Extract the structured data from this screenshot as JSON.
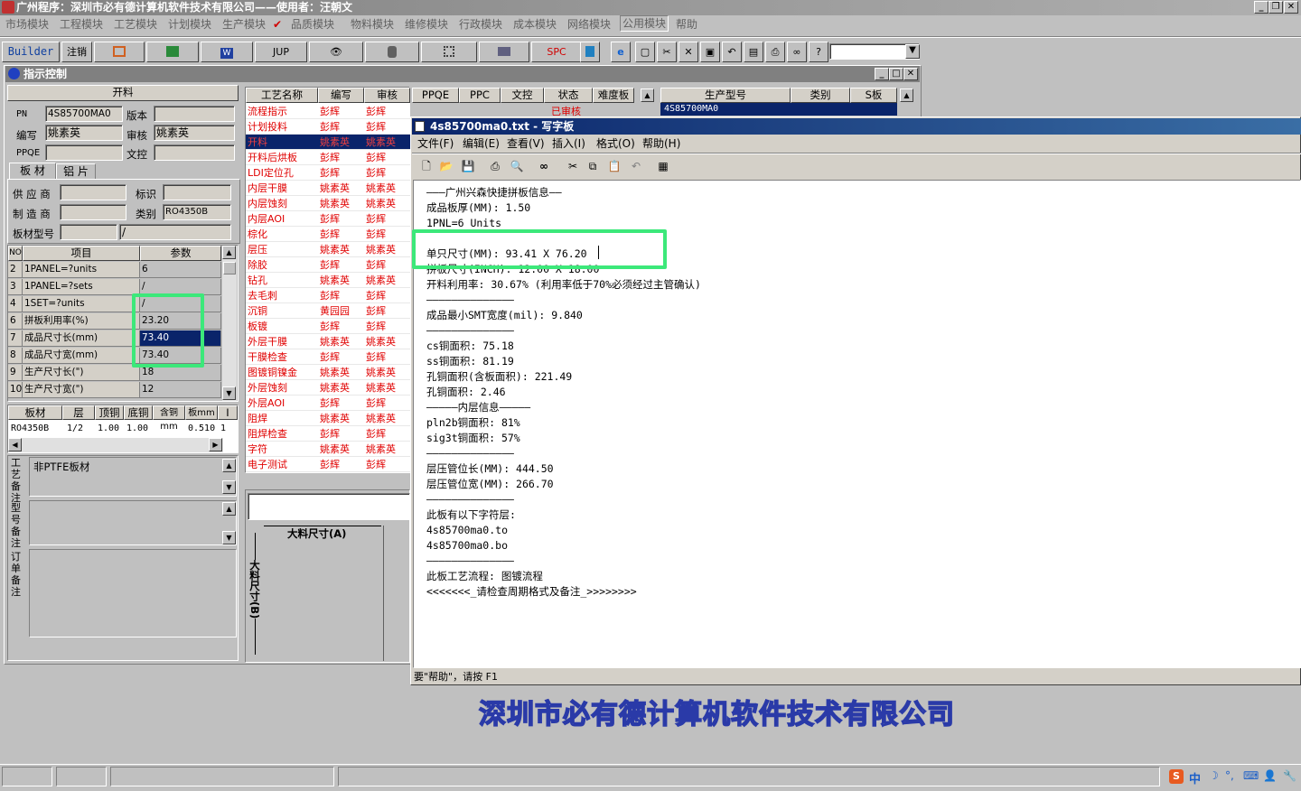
{
  "app": {
    "title": "广州程序：深圳市必有德计算机软件技术有限公司——使用者：汪朝文",
    "menu": [
      "市场模块",
      "工程模块",
      "工艺模块",
      "计划模块",
      "生产模块",
      "品质模块",
      "物料模块",
      "维修模块",
      "行政模块",
      "成本模块",
      "网络模块",
      "公用模块",
      "帮助"
    ],
    "toolbar": {
      "builder": "Builder",
      "logout": "注销",
      "jup": "JUP",
      "spc": "SPC"
    },
    "footer_company": "深圳市必有德计算机软件技术有限公司"
  },
  "panel": {
    "title": "指示控制",
    "section": "开料",
    "pn_label": "PN",
    "pn": "4S85700MA0",
    "version_label": "版本",
    "version": "",
    "author_label": "编写",
    "author": "姚素英",
    "review_label": "审核",
    "reviewer": "姚素英",
    "ppqe_label": "PPQE",
    "ppqe": "",
    "doc_label": "文控",
    "doc": "",
    "tabs": [
      "板 材",
      "铝 片"
    ],
    "supplier_label": "供 应 商",
    "supplier": "",
    "mark_label": "标识",
    "mark": "",
    "maker_label": "制 造 商",
    "maker": "",
    "type_label": "类别",
    "type": "RO4350B",
    "model_label": "板材型号",
    "model": "",
    "model2": "/",
    "param_headers": [
      "NO",
      "项目",
      "参数"
    ],
    "params": [
      {
        "no": "2",
        "item": "1PANEL=?units",
        "val": "6"
      },
      {
        "no": "3",
        "item": "1PANEL=?sets",
        "val": "/"
      },
      {
        "no": "4",
        "item": "1SET=?units",
        "val": "/"
      },
      {
        "no": "6",
        "item": "拼板利用率(%)",
        "val": "23.20"
      },
      {
        "no": "7",
        "item": "成品尺寸长(mm)",
        "val": "73.40"
      },
      {
        "no": "8",
        "item": "成品尺寸宽(mm)",
        "val": "73.40"
      },
      {
        "no": "9",
        "item": "生产尺寸长(\")",
        "val": "18"
      },
      {
        "no": "10",
        "item": "生产尺寸宽(\")",
        "val": "12"
      }
    ],
    "mat_headers": [
      "板材",
      "层",
      "顶铜",
      "底铜",
      "含铜mm",
      "板mm",
      "I"
    ],
    "mat_row": [
      "RO4350B",
      "1/2",
      "1.00",
      "1.00",
      "",
      "0.510",
      "1"
    ],
    "note_labels": [
      "工艺备注",
      "型号备注",
      "订单备注"
    ],
    "note1": "非PTFE板材"
  },
  "process": {
    "headers": [
      "工艺名称",
      "编写",
      "审核"
    ],
    "rows": [
      [
        "流程指示",
        "彭辉",
        "彭辉"
      ],
      [
        "计划投料",
        "彭辉",
        "彭辉"
      ],
      [
        "开料",
        "姚素英",
        "姚素英"
      ],
      [
        "开料后烘板",
        "彭辉",
        "彭辉"
      ],
      [
        "LDI定位孔",
        "彭辉",
        "彭辉"
      ],
      [
        "内层干膜",
        "姚素英",
        "姚素英"
      ],
      [
        "内层蚀刻",
        "姚素英",
        "姚素英"
      ],
      [
        "内层AOI",
        "彭辉",
        "彭辉"
      ],
      [
        "棕化",
        "彭辉",
        "彭辉"
      ],
      [
        "层压",
        "姚素英",
        "姚素英"
      ],
      [
        "除胶",
        "彭辉",
        "彭辉"
      ],
      [
        "钻孔",
        "姚素英",
        "姚素英"
      ],
      [
        "去毛刺",
        "彭辉",
        "彭辉"
      ],
      [
        "沉铜",
        "黄园园",
        "彭辉"
      ],
      [
        "板镀",
        "彭辉",
        "彭辉"
      ],
      [
        "外层干膜",
        "姚素英",
        "姚素英"
      ],
      [
        "干膜检查",
        "彭辉",
        "彭辉"
      ],
      [
        "图镀铜镍金",
        "姚素英",
        "姚素英"
      ],
      [
        "外层蚀刻",
        "姚素英",
        "姚素英"
      ],
      [
        "外层AOI",
        "彭辉",
        "彭辉"
      ],
      [
        "阻焊",
        "姚素英",
        "姚素英"
      ],
      [
        "阻焊检查",
        "彭辉",
        "彭辉"
      ],
      [
        "字符",
        "姚素英",
        "姚素英"
      ],
      [
        "电子测试",
        "彭辉",
        "彭辉"
      ]
    ],
    "diagram_a": "大料尺寸(A)",
    "diagram_b": "大料尺寸(B)"
  },
  "right_headers": [
    "PPQE",
    "PPC",
    "文控",
    "状态",
    "难度板"
  ],
  "right_status": "已审核",
  "model_headers": [
    "生产型号",
    "类别",
    "S板"
  ],
  "model_row": "4S85700MA0",
  "wordpad": {
    "title": "4s85700ma0.txt - 写字板",
    "menu": [
      "文件(F)",
      "编辑(E)",
      "查看(V)",
      "插入(I)",
      "格式(O)",
      "帮助(H)"
    ],
    "lines": [
      "———广州兴森快捷拼板信息——",
      "成品板厚(MM): 1.50",
      "1PNL=6 Units",
      "",
      "单只尺寸(MM): 93.41 X 76.20",
      "拼板尺寸(INCH): 12.00 X 18.00",
      "开料利用率: 30.67% (利用率低于70%必须经过主管确认)",
      "——————————————",
      "成品最小SMT宽度(mil): 9.840",
      "——————————————",
      "cs铜面积: 75.18",
      "ss铜面积: 81.19",
      "孔铜面积(含板面积): 221.49",
      "孔铜面积: 2.46",
      "—————内层信息—————",
      "pln2b铜面积: 81%",
      "sig3t铜面积: 57%",
      "——————————————",
      "层压管位长(MM): 444.50",
      "层压管位宽(MM): 266.70",
      "——————————————",
      "此板有以下字符层:",
      "4s85700ma0.to",
      "4s85700ma0.bo",
      "——————————————",
      "此板工艺流程: 图镀流程",
      "<<<<<<<_请检查周期格式及备注_>>>>>>>>"
    ],
    "status": "要\"帮助\"，请按 F1"
  },
  "tray": {
    "ime": "中"
  }
}
